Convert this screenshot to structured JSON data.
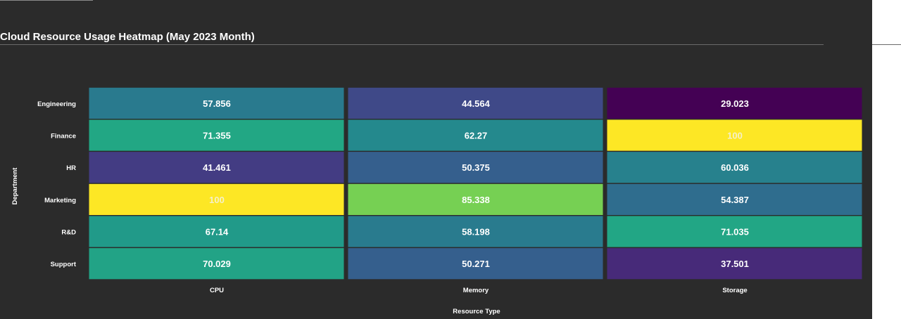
{
  "chart_data": {
    "type": "heatmap",
    "title": "Cloud Resource Usage Heatmap (May 2023 Month)",
    "xlabel": "Resource Type",
    "ylabel": "Department",
    "x": [
      "CPU",
      "Memory",
      "Storage"
    ],
    "y": [
      "Engineering",
      "Finance",
      "HR",
      "Marketing",
      "R&D",
      "Support"
    ],
    "values": [
      [
        57.856,
        44.564,
        29.023
      ],
      [
        71.355,
        62.27,
        100
      ],
      [
        41.461,
        50.375,
        60.036
      ],
      [
        100,
        85.338,
        54.387
      ],
      [
        67.14,
        58.198,
        71.035
      ],
      [
        70.029,
        50.271,
        37.501
      ]
    ],
    "value_labels": [
      [
        "57.856",
        "44.564",
        "29.023"
      ],
      [
        "71.355",
        "62.27",
        "100"
      ],
      [
        "41.461",
        "50.375",
        "60.036"
      ],
      [
        "100",
        "85.338",
        "54.387"
      ],
      [
        "67.14",
        "58.198",
        "71.035"
      ],
      [
        "70.029",
        "50.271",
        "37.501"
      ]
    ],
    "colorscale": "viridis",
    "color_range": [
      29.023,
      100
    ],
    "colorbar": false,
    "grid": false
  },
  "colors": {
    "background": "#2b2b2b",
    "text": "#ffffff",
    "cell_gap": "#2b2b2b"
  }
}
